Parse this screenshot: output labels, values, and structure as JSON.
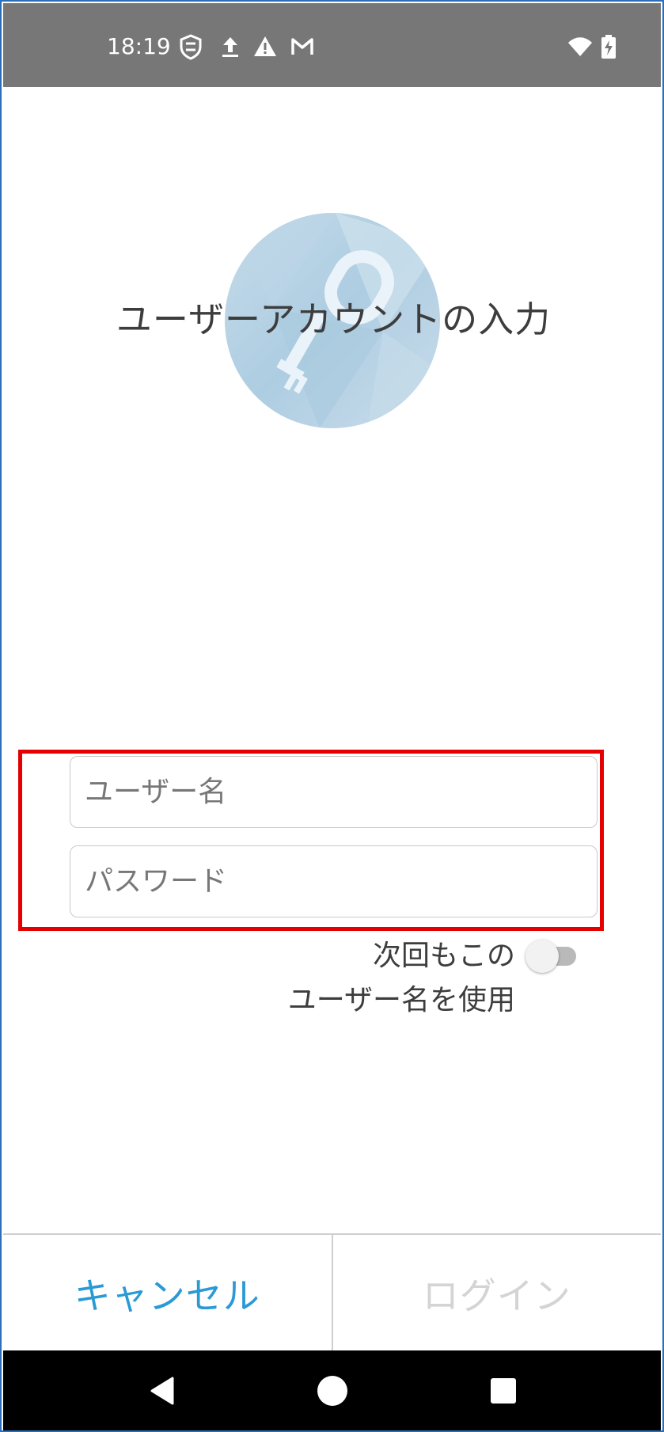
{
  "status_bar": {
    "time": "18:19",
    "icons": [
      "shield-refresh-icon",
      "upload-icon",
      "warning-icon",
      "gmail-icon",
      "wifi-icon",
      "battery-charging-icon"
    ]
  },
  "header": {
    "title": "ユーザーアカウントの入力",
    "illustration": "key-icon"
  },
  "form": {
    "username_placeholder": "ユーザー名",
    "username_value": "",
    "password_placeholder": "パスワード",
    "password_value": ""
  },
  "remember": {
    "label_line1": "次回もこの",
    "label_line2": "ユーザー名を使用",
    "checked": false
  },
  "actions": {
    "cancel_label": "キャンセル",
    "login_label": "ログイン",
    "cancel_color": "#2a9ad6",
    "login_color": "#d4d4d4"
  },
  "nav": {
    "icons": [
      "back-icon",
      "home-icon",
      "recents-icon"
    ]
  },
  "colors": {
    "status_bar": "#777777",
    "highlight": "#e40000",
    "frame": "#2a6fb8"
  }
}
